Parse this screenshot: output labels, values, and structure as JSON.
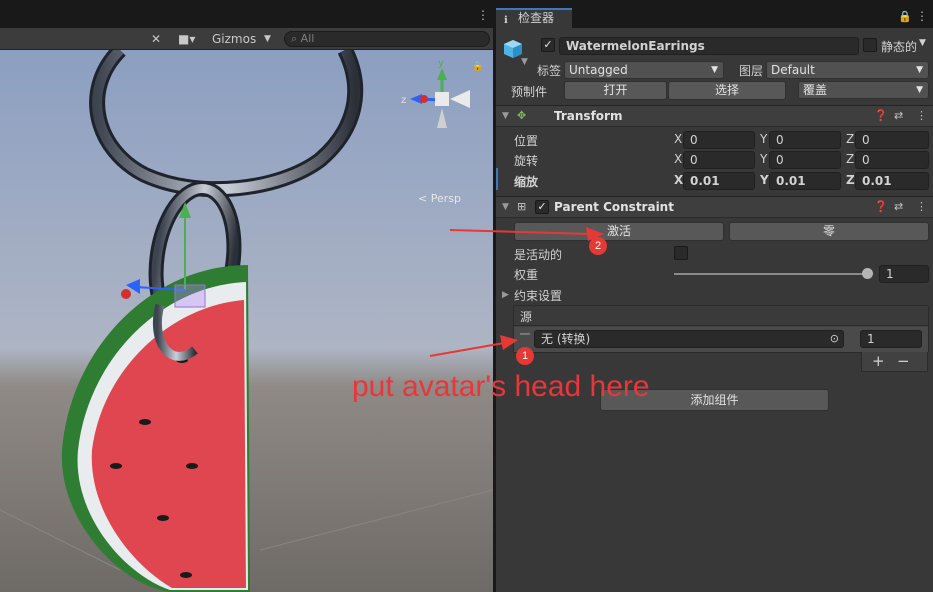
{
  "scene": {
    "gizmos_label": "Gizmos",
    "search_placeholder": "All",
    "persp_label": "< Persp",
    "axis_labels": {
      "y": "y",
      "z": "z"
    }
  },
  "inspector": {
    "tab_label": "检查器",
    "object": {
      "name": "WatermelonEarrings",
      "active": true,
      "static_label": "静态的",
      "tag_label": "标签",
      "tag_value": "Untagged",
      "layer_label": "图层",
      "layer_value": "Default"
    },
    "prefab": {
      "label": "预制件",
      "open_label": "打开",
      "select_label": "选择",
      "overrides_label": "覆盖"
    },
    "transform": {
      "title": "Transform",
      "rows": [
        {
          "label": "位置",
          "x": "0",
          "y": "0",
          "z": "0"
        },
        {
          "label": "旋转",
          "x": "0",
          "y": "0",
          "z": "0"
        },
        {
          "label": "缩放",
          "x": "0.01",
          "y": "0.01",
          "z": "0.01"
        }
      ],
      "axis": {
        "x": "X",
        "y": "Y",
        "z": "Z"
      }
    },
    "parent_constraint": {
      "title": "Parent Constraint",
      "activate_label": "激活",
      "zero_label": "零",
      "is_active_label": "是活动的",
      "weight_label": "权重",
      "weight_value": "1",
      "weight_fraction": 1.0,
      "settings_label": "约束设置",
      "sources_label": "源",
      "source_name": "无 (转换)",
      "source_weight": "1",
      "add_symbol": "+",
      "remove_symbol": "−"
    },
    "add_component_label": "添加组件"
  },
  "annotations": {
    "badge_1": "1",
    "badge_2": "2",
    "instruction": "put avatar's head here",
    "color": "#e53935"
  },
  "icons": {
    "scene_tools": "tools-icon",
    "camera": "camera-icon",
    "search": "search-icon",
    "lock": "lock-icon",
    "menu": "more-vert-icon",
    "cube": "gameobject-cube-icon",
    "transform": "transform-icon",
    "constraint": "constraint-icon",
    "help": "help-icon",
    "settings": "preset-icon",
    "target": "object-picker-icon"
  }
}
